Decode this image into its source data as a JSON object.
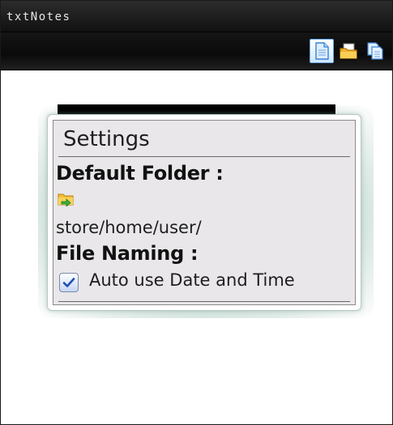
{
  "app": {
    "title": "txtNotes"
  },
  "toolbar": {
    "buttons": [
      {
        "icon": "new-note-icon",
        "selected": true
      },
      {
        "icon": "open-folder-icon",
        "selected": false
      },
      {
        "icon": "copy-note-icon",
        "selected": false
      }
    ]
  },
  "settings": {
    "header": "Settings",
    "default_folder_label": "Default Folder :",
    "folder_icon": "folder-arrow-icon",
    "folder_path": "store/home/user/",
    "file_naming_label": "File Naming :",
    "auto_date_time_label": "Auto use Date and Time",
    "auto_date_time_checked": true
  },
  "colors": {
    "titlebar": "#1c1c1c",
    "toolbar": "#101010",
    "dialog_bg": "#e9e7ea",
    "selection": "#6aa9e8",
    "check": "#1d4fb3"
  }
}
